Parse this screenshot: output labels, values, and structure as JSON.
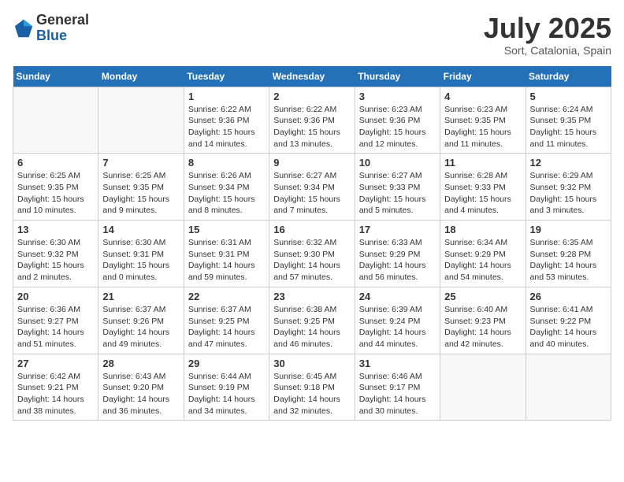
{
  "logo": {
    "general": "General",
    "blue": "Blue"
  },
  "title": "July 2025",
  "subtitle": "Sort, Catalonia, Spain",
  "days_header": [
    "Sunday",
    "Monday",
    "Tuesday",
    "Wednesday",
    "Thursday",
    "Friday",
    "Saturday"
  ],
  "weeks": [
    [
      {
        "day": "",
        "info": ""
      },
      {
        "day": "",
        "info": ""
      },
      {
        "day": "1",
        "info": "Sunrise: 6:22 AM\nSunset: 9:36 PM\nDaylight: 15 hours\nand 14 minutes."
      },
      {
        "day": "2",
        "info": "Sunrise: 6:22 AM\nSunset: 9:36 PM\nDaylight: 15 hours\nand 13 minutes."
      },
      {
        "day": "3",
        "info": "Sunrise: 6:23 AM\nSunset: 9:36 PM\nDaylight: 15 hours\nand 12 minutes."
      },
      {
        "day": "4",
        "info": "Sunrise: 6:23 AM\nSunset: 9:35 PM\nDaylight: 15 hours\nand 11 minutes."
      },
      {
        "day": "5",
        "info": "Sunrise: 6:24 AM\nSunset: 9:35 PM\nDaylight: 15 hours\nand 11 minutes."
      }
    ],
    [
      {
        "day": "6",
        "info": "Sunrise: 6:25 AM\nSunset: 9:35 PM\nDaylight: 15 hours\nand 10 minutes."
      },
      {
        "day": "7",
        "info": "Sunrise: 6:25 AM\nSunset: 9:35 PM\nDaylight: 15 hours\nand 9 minutes."
      },
      {
        "day": "8",
        "info": "Sunrise: 6:26 AM\nSunset: 9:34 PM\nDaylight: 15 hours\nand 8 minutes."
      },
      {
        "day": "9",
        "info": "Sunrise: 6:27 AM\nSunset: 9:34 PM\nDaylight: 15 hours\nand 7 minutes."
      },
      {
        "day": "10",
        "info": "Sunrise: 6:27 AM\nSunset: 9:33 PM\nDaylight: 15 hours\nand 5 minutes."
      },
      {
        "day": "11",
        "info": "Sunrise: 6:28 AM\nSunset: 9:33 PM\nDaylight: 15 hours\nand 4 minutes."
      },
      {
        "day": "12",
        "info": "Sunrise: 6:29 AM\nSunset: 9:32 PM\nDaylight: 15 hours\nand 3 minutes."
      }
    ],
    [
      {
        "day": "13",
        "info": "Sunrise: 6:30 AM\nSunset: 9:32 PM\nDaylight: 15 hours\nand 2 minutes."
      },
      {
        "day": "14",
        "info": "Sunrise: 6:30 AM\nSunset: 9:31 PM\nDaylight: 15 hours\nand 0 minutes."
      },
      {
        "day": "15",
        "info": "Sunrise: 6:31 AM\nSunset: 9:31 PM\nDaylight: 14 hours\nand 59 minutes."
      },
      {
        "day": "16",
        "info": "Sunrise: 6:32 AM\nSunset: 9:30 PM\nDaylight: 14 hours\nand 57 minutes."
      },
      {
        "day": "17",
        "info": "Sunrise: 6:33 AM\nSunset: 9:29 PM\nDaylight: 14 hours\nand 56 minutes."
      },
      {
        "day": "18",
        "info": "Sunrise: 6:34 AM\nSunset: 9:29 PM\nDaylight: 14 hours\nand 54 minutes."
      },
      {
        "day": "19",
        "info": "Sunrise: 6:35 AM\nSunset: 9:28 PM\nDaylight: 14 hours\nand 53 minutes."
      }
    ],
    [
      {
        "day": "20",
        "info": "Sunrise: 6:36 AM\nSunset: 9:27 PM\nDaylight: 14 hours\nand 51 minutes."
      },
      {
        "day": "21",
        "info": "Sunrise: 6:37 AM\nSunset: 9:26 PM\nDaylight: 14 hours\nand 49 minutes."
      },
      {
        "day": "22",
        "info": "Sunrise: 6:37 AM\nSunset: 9:25 PM\nDaylight: 14 hours\nand 47 minutes."
      },
      {
        "day": "23",
        "info": "Sunrise: 6:38 AM\nSunset: 9:25 PM\nDaylight: 14 hours\nand 46 minutes."
      },
      {
        "day": "24",
        "info": "Sunrise: 6:39 AM\nSunset: 9:24 PM\nDaylight: 14 hours\nand 44 minutes."
      },
      {
        "day": "25",
        "info": "Sunrise: 6:40 AM\nSunset: 9:23 PM\nDaylight: 14 hours\nand 42 minutes."
      },
      {
        "day": "26",
        "info": "Sunrise: 6:41 AM\nSunset: 9:22 PM\nDaylight: 14 hours\nand 40 minutes."
      }
    ],
    [
      {
        "day": "27",
        "info": "Sunrise: 6:42 AM\nSunset: 9:21 PM\nDaylight: 14 hours\nand 38 minutes."
      },
      {
        "day": "28",
        "info": "Sunrise: 6:43 AM\nSunset: 9:20 PM\nDaylight: 14 hours\nand 36 minutes."
      },
      {
        "day": "29",
        "info": "Sunrise: 6:44 AM\nSunset: 9:19 PM\nDaylight: 14 hours\nand 34 minutes."
      },
      {
        "day": "30",
        "info": "Sunrise: 6:45 AM\nSunset: 9:18 PM\nDaylight: 14 hours\nand 32 minutes."
      },
      {
        "day": "31",
        "info": "Sunrise: 6:46 AM\nSunset: 9:17 PM\nDaylight: 14 hours\nand 30 minutes."
      },
      {
        "day": "",
        "info": ""
      },
      {
        "day": "",
        "info": ""
      }
    ]
  ]
}
